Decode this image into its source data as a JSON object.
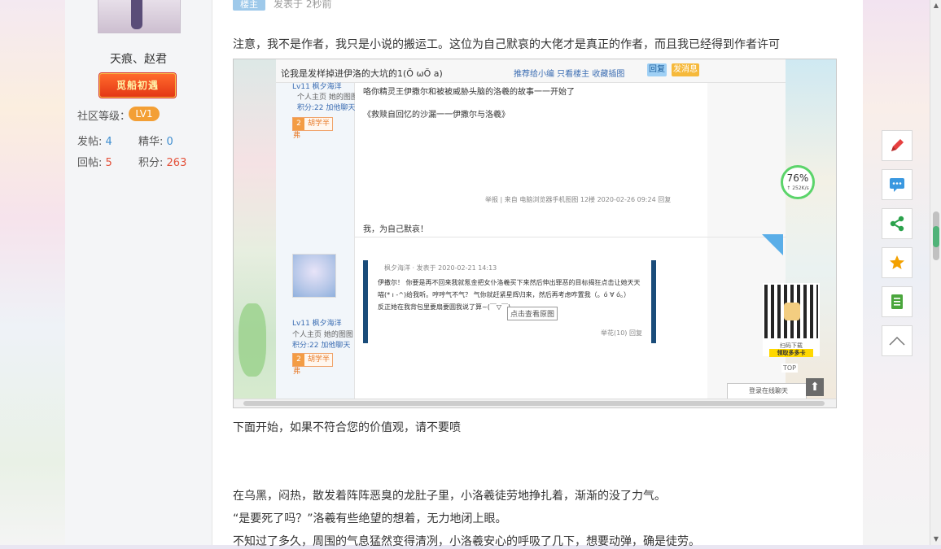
{
  "sidebar": {
    "username": "天痕、赵君",
    "medal_text": "觅船初遇",
    "level_label": "社区等级：",
    "level_badge": "LV1",
    "stats": {
      "posts_label": "发帖:",
      "posts_value": "4",
      "digest_label": "精华:",
      "digest_value": "0",
      "replies_label": "回帖:",
      "replies_value": "5",
      "points_label": "积分:",
      "points_value": "263"
    }
  },
  "post": {
    "floor_tag": "楼主",
    "meta": "发表于 2秒前",
    "line1": "注意，我不是作者，我只是小说的搬运工。这位为自己默哀的大佬才是真正的作者，而且我已经得到作者许可",
    "line2": "下面开始，如果不符合您的价值观，请不要喷",
    "line3": "在乌黑，闷热，散发着阵阵恶臭的龙肚子里，小洛羲徒劳地挣扎着，渐渐的没了力气。",
    "line4": "“是要死了吗？”洛羲有些绝望的想着，无力地闭上眼。",
    "line5": "不知过了多久，周围的气息猛然变得清冽，小洛羲安心的呼吸了几下，想要动弹，确是徒劳。"
  },
  "screenshot": {
    "title": "论我是发样掉进伊洛的大坑的1(Ŏ ωŎ a)",
    "links": "推荐给小编  只看楼主  收藏插图",
    "btn_reply": "回复",
    "btn_post": "发消息",
    "post1": {
      "level_user": "Lv11  枫夕海洋",
      "links_a": "个人主页  她的图图",
      "links_b": "积分:22  加他聊天",
      "badge": "胡学半弗",
      "line1": "咯你精灵王伊撒尔和被被威胁头脑的洛羲的故事一一开始了",
      "line2": "《救赎自回忆的沙漏一一伊撒尔与洛羲》",
      "footer": "举报 | 来自 电脑浏览器手机图图 12楼 2020-02-26 09:24 回复"
    },
    "post2": {
      "level_user": "Lv11  枫夕海洋",
      "links_a": "个人主页  她的图图",
      "links_b": "积分:22  加他聊天",
      "badge": "胡学半弗",
      "content": "我，为自己默哀！",
      "quote_header": "枫夕海洋 · 发表于 2020-02-21 14:13",
      "quote_l1": "伊撒尔！ 你要是再不回来我就氪金把女仆洛羲买下来然后伸出罪恶的目标揭狂点击让她天天",
      "quote_l2": "喵(* ı -^)给我听。哼哼气不气？ 气你就赶紧星辉归来，然后再考虑咋置我（。ó ∀ ó。）",
      "quote_l3": "反正她在我背包里要扇要圆我说了算~(￣▽￣)~",
      "tooltip": "点击查看原图",
      "quote_footer": "举花(10)  回复"
    },
    "gauge_value": "76%",
    "gauge_sub": "↑ 252K/s",
    "qr_label": "扫码下载",
    "qr_yellow": "领取多多卡",
    "top_link": "TOP",
    "chat_box": "登录在线聊天"
  },
  "toolbar": {
    "icons": [
      "edit-icon",
      "comment-icon",
      "share-icon",
      "favorite-icon",
      "document-icon",
      "scroll-top-icon"
    ],
    "colors": {
      "edit": "#e64040",
      "comment": "#3a98e0",
      "share": "#2ba24c",
      "favorite": "#f3a100",
      "document": "#4aa63c"
    }
  }
}
